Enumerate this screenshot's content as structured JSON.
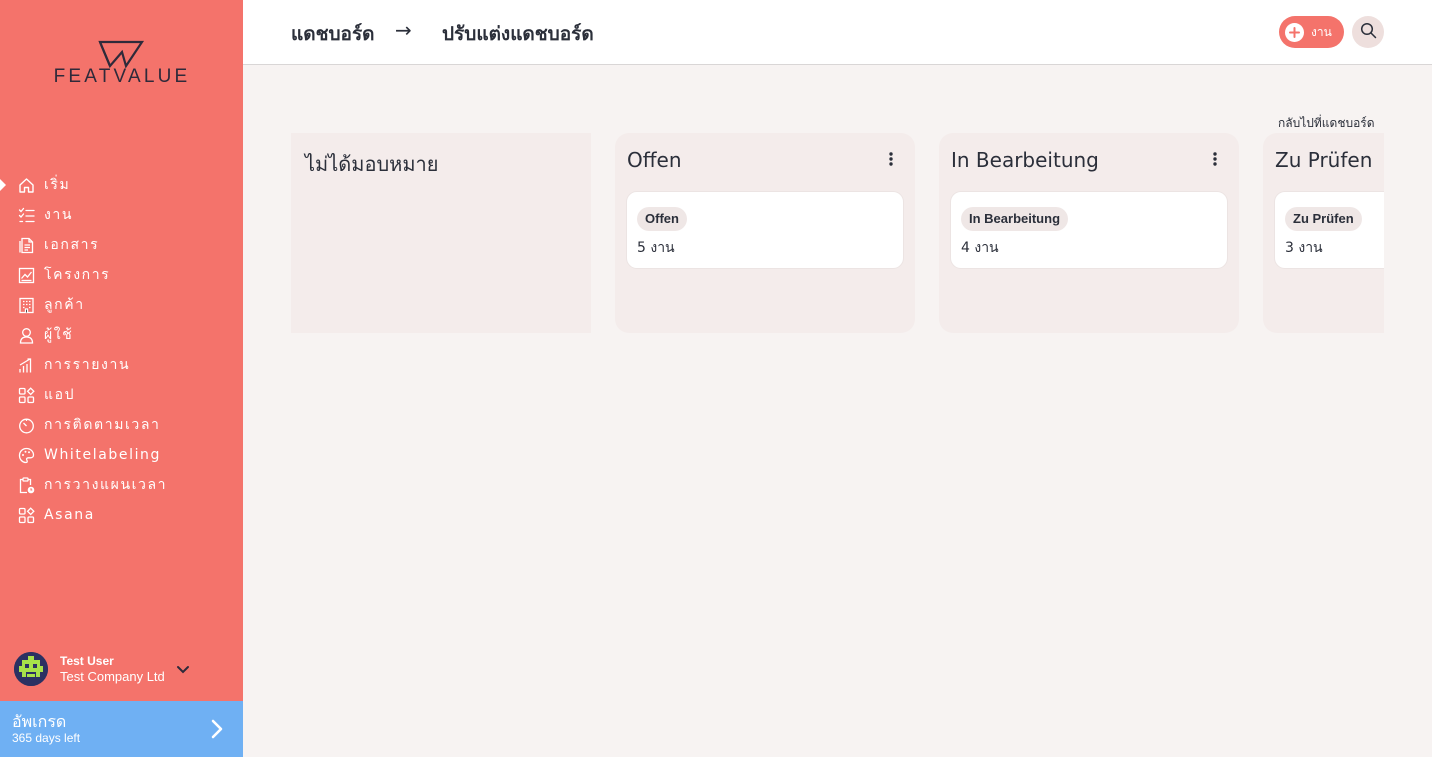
{
  "brand": {
    "name": "FEATVALUE"
  },
  "sidebar": {
    "items": [
      {
        "label": "เริ่ม",
        "icon": "home-icon",
        "active": true
      },
      {
        "label": "งาน",
        "icon": "task-list-icon"
      },
      {
        "label": "เอกสาร",
        "icon": "document-icon"
      },
      {
        "label": "โครงการ",
        "icon": "chart-board-icon"
      },
      {
        "label": "ลูกค้า",
        "icon": "building-icon"
      },
      {
        "label": "ผู้ใช้",
        "icon": "user-icon"
      },
      {
        "label": "การรายงาน",
        "icon": "bar-chart-icon"
      },
      {
        "label": "แอป",
        "icon": "apps-icon"
      },
      {
        "label": "การติดตามเวลา",
        "icon": "timer-icon"
      },
      {
        "label": "Whitelabeling",
        "icon": "palette-icon"
      },
      {
        "label": "การวางแผนเวลา",
        "icon": "clipboard-clock-icon"
      },
      {
        "label": "Asana",
        "icon": "apps-icon"
      }
    ],
    "user": {
      "name": "Test User",
      "company": "Test Company Ltd"
    },
    "upgrade": {
      "title": "อัพเกรด",
      "subtitle": "365 days left"
    }
  },
  "header": {
    "breadcrumb": {
      "parent": "แดชบอร์ด",
      "separator": "→",
      "current": "ปรับแต่งแดชบอร์ด"
    },
    "add_button_label": "งาน"
  },
  "main": {
    "back_link": "กลับไปที่แดชบอร์ด",
    "columns": [
      {
        "title": "ไม่ได้มอบหมาย"
      },
      {
        "title": "Offen",
        "card": {
          "status": "Offen",
          "count": "5 งาน"
        }
      },
      {
        "title": "In Bearbeitung",
        "card": {
          "status": "In Bearbeitung",
          "count": "4 งาน"
        }
      },
      {
        "title": "Zu Prüfen",
        "card": {
          "status": "Zu Prüfen",
          "count": "3 งาน"
        }
      }
    ]
  },
  "colors": {
    "sidebar": "#f4736b",
    "upgrade": "#6fb0f3",
    "background": "#f7f3f2",
    "column": "#f4eceb"
  }
}
